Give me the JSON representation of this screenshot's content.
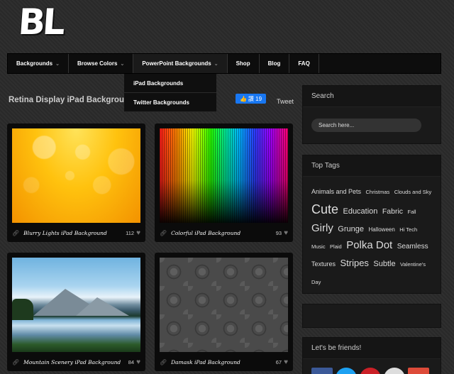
{
  "logo": {
    "text": "BL"
  },
  "nav": {
    "items": [
      {
        "label": "Backgrounds",
        "dropdown": true
      },
      {
        "label": "Browse Colors",
        "dropdown": true
      },
      {
        "label": "PowerPoint Backgrounds",
        "dropdown": true
      },
      {
        "label": "Shop",
        "dropdown": false
      },
      {
        "label": "Blog",
        "dropdown": false
      },
      {
        "label": "FAQ",
        "dropdown": false
      }
    ],
    "open_dropdown": [
      {
        "label": "iPad Backgrounds"
      },
      {
        "label": "Twitter Backgrounds"
      }
    ]
  },
  "page": {
    "title": "Retina Display iPad Backgrounds",
    "like_label": "讚 19",
    "tweet_label": "Tweet"
  },
  "cards": [
    {
      "title": "Blurry Lights iPad Background",
      "likes": "112"
    },
    {
      "title": "Colorful iPad Background",
      "likes": "93"
    },
    {
      "title": "Mountain Scenery iPad Background",
      "likes": "84"
    },
    {
      "title": "Damask iPad Background",
      "likes": "67"
    }
  ],
  "sidebar": {
    "search": {
      "title": "Search",
      "placeholder": "Search here..."
    },
    "tags": {
      "title": "Top Tags",
      "items": [
        {
          "label": "Animals and Pets",
          "size": 9
        },
        {
          "label": "Christmas",
          "size": 7.5
        },
        {
          "label": "Clouds and Sky",
          "size": 7.5
        },
        {
          "label": "Cute",
          "size": 18
        },
        {
          "label": "Education",
          "size": 11
        },
        {
          "label": "Fabric",
          "size": 10.5
        },
        {
          "label": "Fall",
          "size": 7.5
        },
        {
          "label": "Girly",
          "size": 15
        },
        {
          "label": "Grunge",
          "size": 11
        },
        {
          "label": "Halloween",
          "size": 8
        },
        {
          "label": "Hi Tech",
          "size": 7.5
        },
        {
          "label": "Music",
          "size": 7.5
        },
        {
          "label": "Plaid",
          "size": 7.5
        },
        {
          "label": "Polka Dot",
          "size": 15
        },
        {
          "label": "Seamless",
          "size": 10
        },
        {
          "label": "Textures",
          "size": 9
        },
        {
          "label": "Stripes",
          "size": 13
        },
        {
          "label": "Subtle",
          "size": 11
        },
        {
          "label": "Valentine's Day",
          "size": 7.5
        }
      ]
    },
    "friends": {
      "title": "Let's be friends!",
      "icons": [
        {
          "name": "facebook-icon",
          "glyph": "f",
          "color": "#3b5998"
        },
        {
          "name": "twitter-icon",
          "glyph": "t",
          "color": "#1da1f2"
        },
        {
          "name": "pinterest-icon",
          "glyph": "P",
          "color": "#cb2027"
        },
        {
          "name": "rss-icon",
          "glyph": "◉",
          "color": "#dddddd"
        },
        {
          "name": "googleplus-icon",
          "glyph": "g+",
          "color": "#dd4b39"
        }
      ]
    }
  }
}
